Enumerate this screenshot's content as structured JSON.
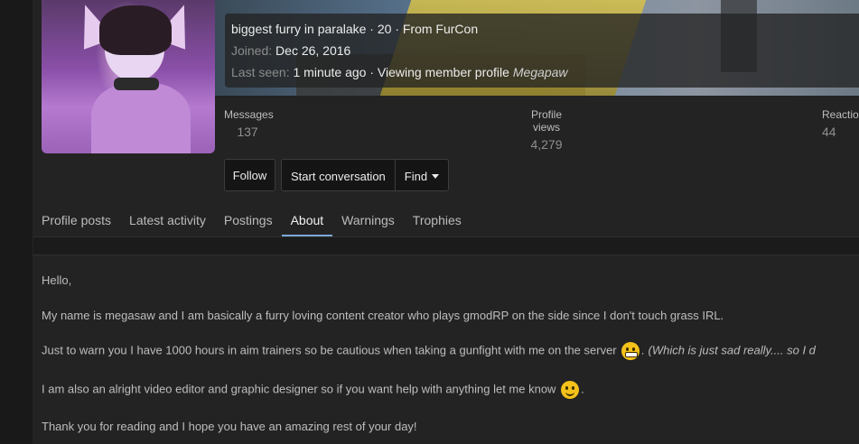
{
  "profile": {
    "tagline": "biggest furry in paralake · 20 · From FurCon",
    "joined_label": "Joined:",
    "joined_value": "Dec 26, 2016",
    "last_seen_label": "Last seen:",
    "last_seen_value": "1 minute ago · Viewing member profile",
    "last_seen_target": "Megapaw"
  },
  "stats": {
    "messages_label": "Messages",
    "messages_value": "137",
    "views_label": "Profile views",
    "views_value": "4,279",
    "reactions_label": "Reaction",
    "reactions_value": "44"
  },
  "buttons": {
    "follow": "Follow",
    "start_conversation": "Start conversation",
    "find": "Find"
  },
  "tabs": [
    "Profile posts",
    "Latest activity",
    "Postings",
    "About",
    "Warnings",
    "Trophies"
  ],
  "active_tab": "About",
  "about": {
    "line1": "Hello,",
    "line2": "My name is megasaw and I am basically a furry loving content creator who plays gmodRP on the side since I don't touch grass IRL.",
    "line3_a": "Just to warn you I have 1000 hours in aim trainers so be cautious when taking a gunfight with me on the server",
    "line3_b": ". (Which is just sad really.... so I d",
    "line4_a": "I am also an alright video editor and graphic designer so if you want help with anything let me know",
    "line4_b": ".",
    "line5": "Thank you for reading and I hope you have an amazing rest of your day!"
  },
  "icons": {
    "emoji1": "grinning-face-icon",
    "emoji2": "smiling-face-icon",
    "find_caret": "caret-down-icon"
  },
  "colors": {
    "page_bg": "#1b1b1b",
    "card_bg": "#232323",
    "active_tab_underline": "#7aa8d6"
  }
}
